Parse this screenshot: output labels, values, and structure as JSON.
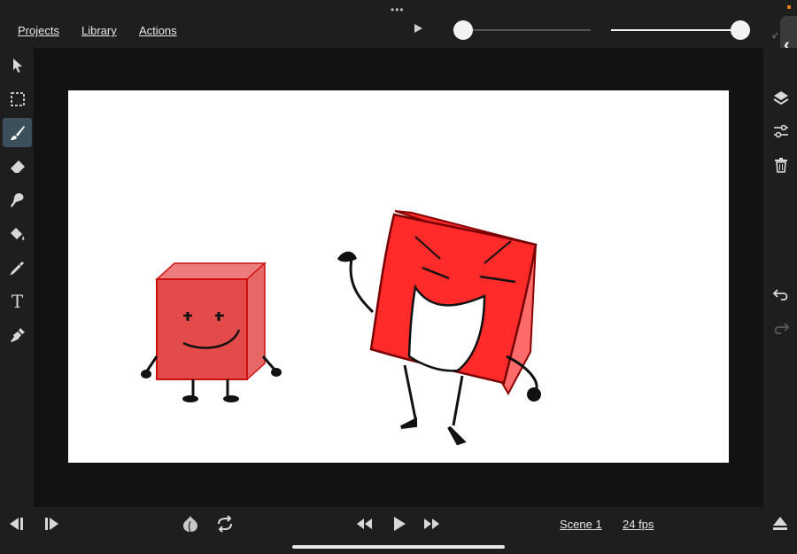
{
  "menu": {
    "projects": "Projects",
    "library": "Library",
    "actions": "Actions"
  },
  "top": {
    "grabber": "•••",
    "playback_slider_value": 0.0,
    "opacity_slider_value": 1.0
  },
  "tools": [
    {
      "name": "select-arrow",
      "icon": "arrow-pointer-icon"
    },
    {
      "name": "marquee-select",
      "icon": "dashed-rect-icon"
    },
    {
      "name": "brush",
      "icon": "brush-icon",
      "active": true
    },
    {
      "name": "eraser",
      "icon": "eraser-icon"
    },
    {
      "name": "smudge",
      "icon": "smudge-icon"
    },
    {
      "name": "fill",
      "icon": "paint-bucket-icon"
    },
    {
      "name": "eyedropper",
      "icon": "eyedropper-icon"
    },
    {
      "name": "text",
      "icon": "text-icon",
      "glyph": "T"
    },
    {
      "name": "pen",
      "icon": "pen-nib-icon"
    }
  ],
  "right_tools": [
    "color-swatch-icon",
    "layers-icon",
    "sliders-icon",
    "trash-icon",
    "undo-icon",
    "redo-icon"
  ],
  "bottom": {
    "scene": "Scene 1",
    "fps": "24 fps",
    "buttons": [
      "prev-frame-icon",
      "next-frame-icon",
      "onion-skin-icon",
      "loop-icon",
      "rewind-icon",
      "play-icon",
      "fast-forward-icon",
      "eject-icon"
    ]
  },
  "colors": {
    "ui_bg": "#1e1e1e",
    "stage_bg": "#121212",
    "canvas_bg": "#ffffff",
    "active_tool": "#3d4f5a",
    "character_red": "#ff2a2a",
    "character_red_dark": "#e34b4b"
  }
}
